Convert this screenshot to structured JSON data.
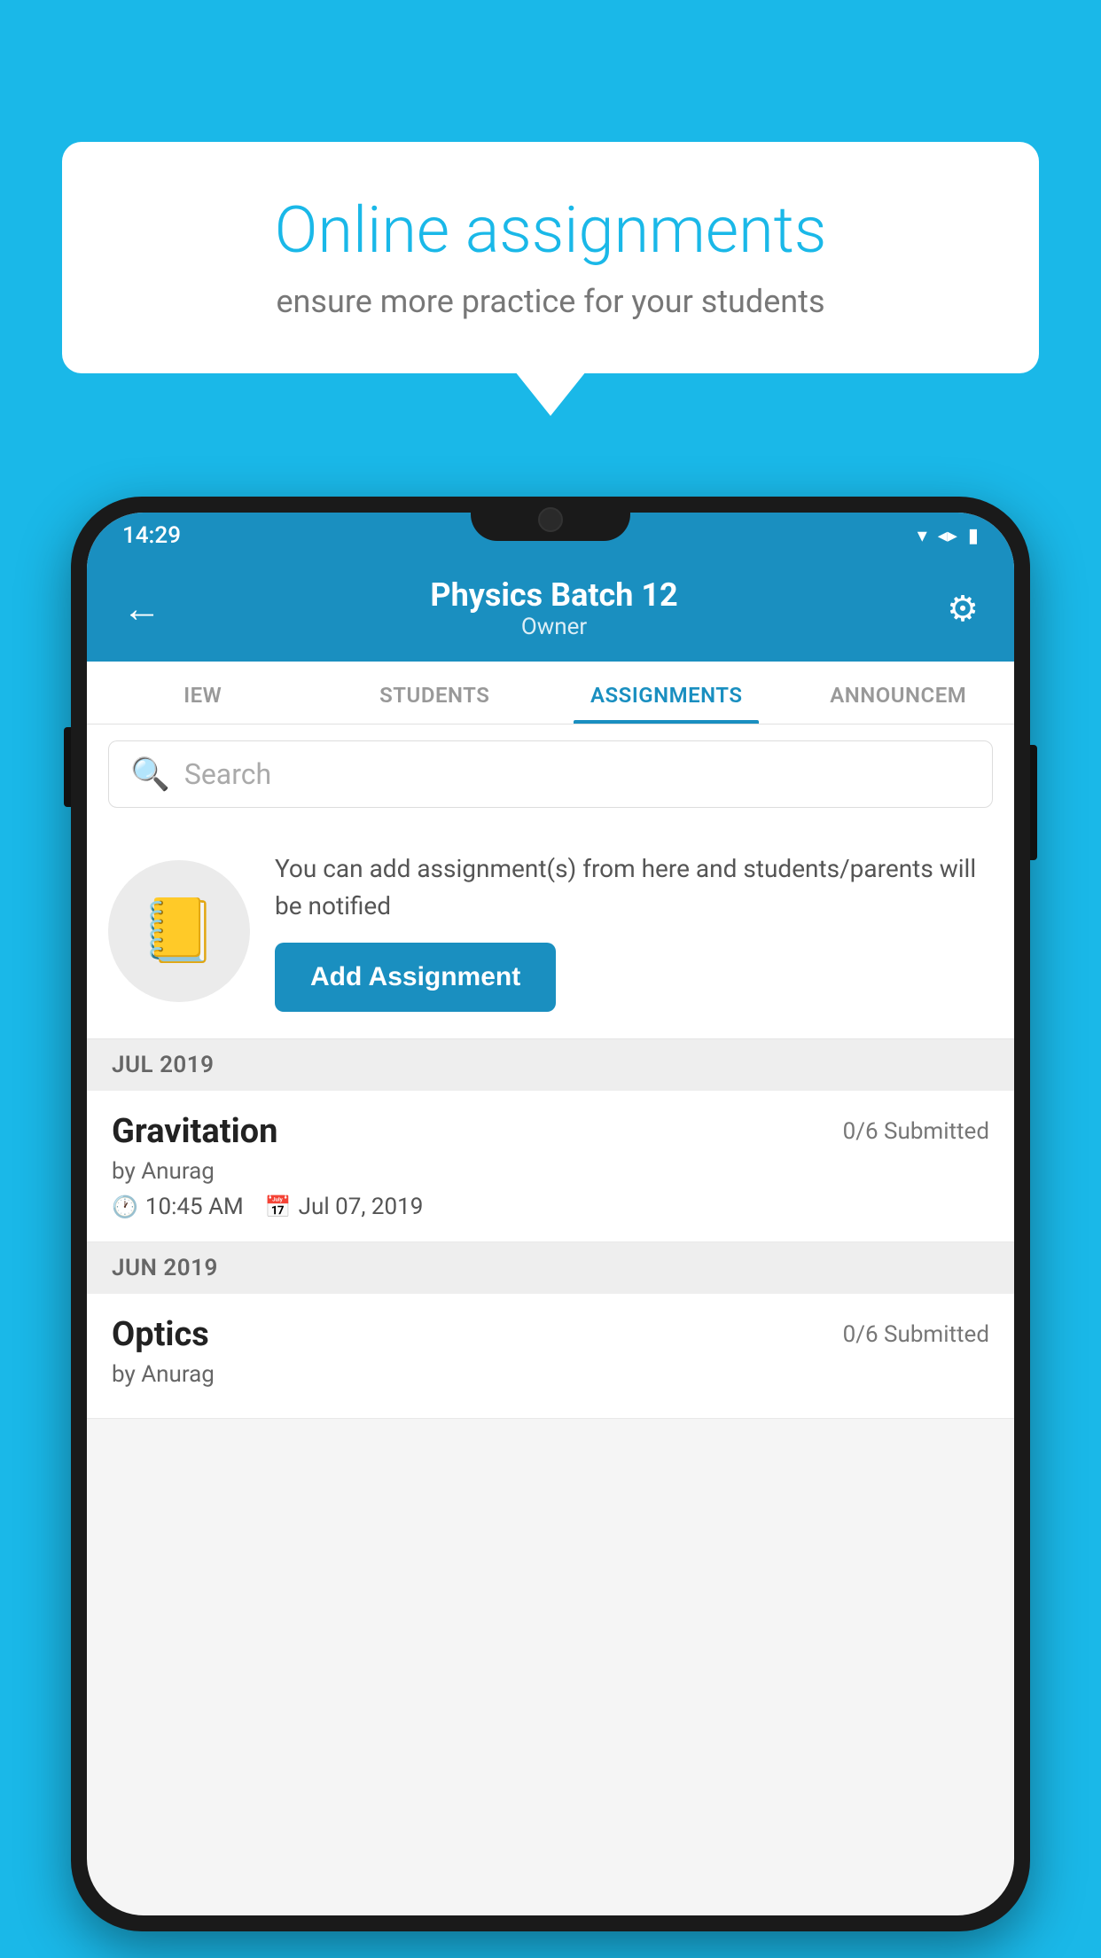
{
  "background": {
    "color": "#1ab8e8"
  },
  "speech_bubble": {
    "title": "Online assignments",
    "subtitle": "ensure more practice for your students"
  },
  "status_bar": {
    "time": "14:29",
    "icons": [
      "wifi",
      "signal",
      "battery"
    ]
  },
  "header": {
    "title": "Physics Batch 12",
    "subtitle": "Owner",
    "back_label": "←",
    "settings_label": "⚙"
  },
  "tabs": [
    {
      "label": "IEW",
      "active": false
    },
    {
      "label": "STUDENTS",
      "active": false
    },
    {
      "label": "ASSIGNMENTS",
      "active": true
    },
    {
      "label": "ANNOUNCEM",
      "active": false
    }
  ],
  "search": {
    "placeholder": "Search"
  },
  "promo": {
    "description": "You can add assignment(s) from here and students/parents will be notified",
    "add_button_label": "Add Assignment"
  },
  "sections": [
    {
      "header": "JUL 2019",
      "assignments": [
        {
          "name": "Gravitation",
          "submitted": "0/6 Submitted",
          "by": "by Anurag",
          "time": "10:45 AM",
          "date": "Jul 07, 2019"
        }
      ]
    },
    {
      "header": "JUN 2019",
      "assignments": [
        {
          "name": "Optics",
          "submitted": "0/6 Submitted",
          "by": "by Anurag",
          "time": "",
          "date": ""
        }
      ]
    }
  ]
}
